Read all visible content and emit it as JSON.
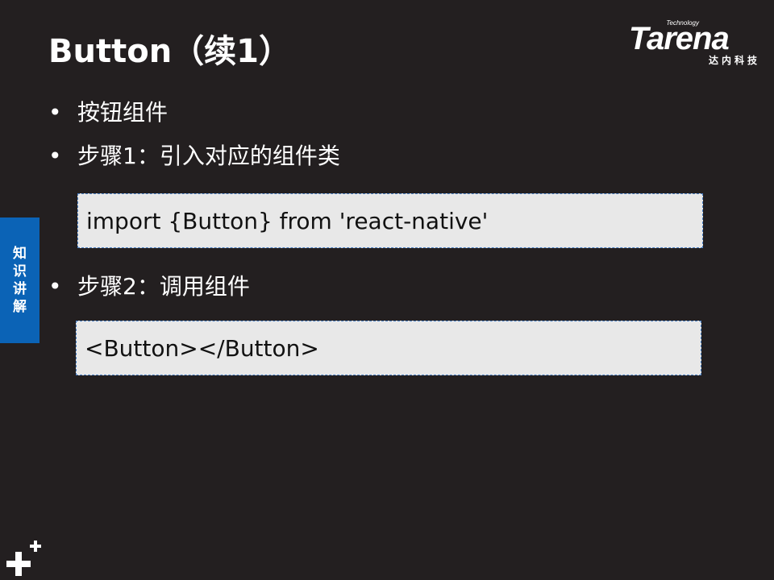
{
  "slide": {
    "title": "Button（续1）",
    "logo": {
      "tagline": "Technology",
      "wordmark": "Tarena",
      "chinese": "达内科技"
    },
    "side_tab": "知识讲解",
    "bullets": [
      {
        "marker": "•",
        "text": "按钮组件"
      },
      {
        "marker": "•",
        "text": "步骤1：引入对应的组件类"
      },
      {
        "marker": "•",
        "text": "步骤2：调用组件"
      }
    ],
    "code_blocks": [
      "import {Button} from 'react-native'",
      "<Button></Button>"
    ]
  },
  "colors": {
    "background": "#231f20",
    "side_tab": "#0b63b6",
    "code_box": "#e8e8e8",
    "code_border": "#4a7fc2"
  },
  "icons": [
    "plus-icon"
  ]
}
